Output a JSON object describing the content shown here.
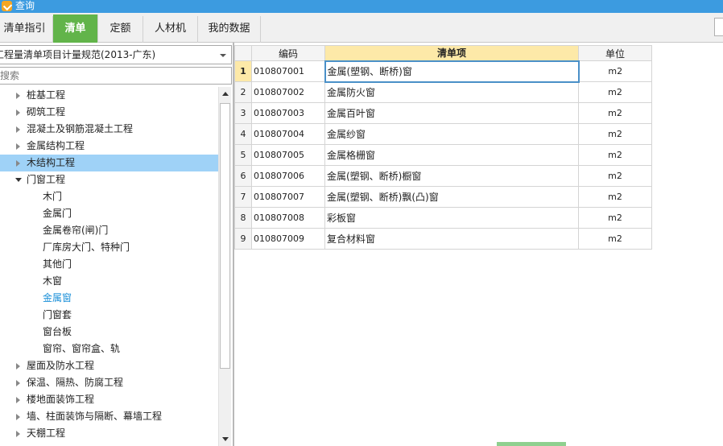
{
  "window": {
    "title": "查询"
  },
  "tabs": [
    {
      "label": "清单指引",
      "active": false
    },
    {
      "label": "清单",
      "active": true
    },
    {
      "label": "定额",
      "active": false
    },
    {
      "label": "人材机",
      "active": false
    },
    {
      "label": "我的数据",
      "active": false
    }
  ],
  "left": {
    "spec_select": "工程量清单项目计量规范(2013-广东)",
    "search_placeholder": "搜索",
    "tree": [
      {
        "label": "桩基工程",
        "level": 0,
        "state": "collapsed"
      },
      {
        "label": "砌筑工程",
        "level": 0,
        "state": "collapsed"
      },
      {
        "label": "混凝土及钢筋混凝土工程",
        "level": 0,
        "state": "collapsed"
      },
      {
        "label": "金属结构工程",
        "level": 0,
        "state": "collapsed"
      },
      {
        "label": "木结构工程",
        "level": 0,
        "state": "collapsed",
        "selected": true
      },
      {
        "label": "门窗工程",
        "level": 0,
        "state": "expanded"
      },
      {
        "label": "木门",
        "level": 1
      },
      {
        "label": "金属门",
        "level": 1
      },
      {
        "label": "金属卷帘(闸)门",
        "level": 1
      },
      {
        "label": "厂库房大门、特种门",
        "level": 1
      },
      {
        "label": "其他门",
        "level": 1
      },
      {
        "label": "木窗",
        "level": 1
      },
      {
        "label": "金属窗",
        "level": 1,
        "highlight": true
      },
      {
        "label": "门窗套",
        "level": 1
      },
      {
        "label": "窗台板",
        "level": 1
      },
      {
        "label": "窗帘、窗帘盒、轨",
        "level": 1
      },
      {
        "label": "屋面及防水工程",
        "level": 0,
        "state": "collapsed"
      },
      {
        "label": "保温、隔热、防腐工程",
        "level": 0,
        "state": "collapsed"
      },
      {
        "label": "楼地面装饰工程",
        "level": 0,
        "state": "collapsed"
      },
      {
        "label": "墙、柱面装饰与隔断、幕墙工程",
        "level": 0,
        "state": "collapsed"
      },
      {
        "label": "天棚工程",
        "level": 0,
        "state": "collapsed"
      }
    ]
  },
  "grid": {
    "headers": {
      "rownum": "",
      "code": "编码",
      "name": "清单项",
      "unit": "单位"
    },
    "rows": [
      {
        "num": "1",
        "code": "010807001",
        "name": "金属(塑钢、断桥)窗",
        "unit": "m2"
      },
      {
        "num": "2",
        "code": "010807002",
        "name": "金属防火窗",
        "unit": "m2"
      },
      {
        "num": "3",
        "code": "010807003",
        "name": "金属百叶窗",
        "unit": "m2"
      },
      {
        "num": "4",
        "code": "010807004",
        "name": "金属纱窗",
        "unit": "m2"
      },
      {
        "num": "5",
        "code": "010807005",
        "name": "金属格栅窗",
        "unit": "m2"
      },
      {
        "num": "6",
        "code": "010807006",
        "name": "金属(塑钢、断桥)橱窗",
        "unit": "m2"
      },
      {
        "num": "7",
        "code": "010807007",
        "name": "金属(塑钢、断桥)飘(凸)窗",
        "unit": "m2"
      },
      {
        "num": "8",
        "code": "010807008",
        "name": "彩板窗",
        "unit": "m2"
      },
      {
        "num": "9",
        "code": "010807009",
        "name": "复合材料窗",
        "unit": "m2"
      }
    ]
  },
  "colors": {
    "titlebar": "#3c9be0",
    "active_tab": "#62b44a",
    "selected_row": "#9fd2f7",
    "sorted_header": "#fde9a8",
    "link_text": "#1a8fd8"
  }
}
